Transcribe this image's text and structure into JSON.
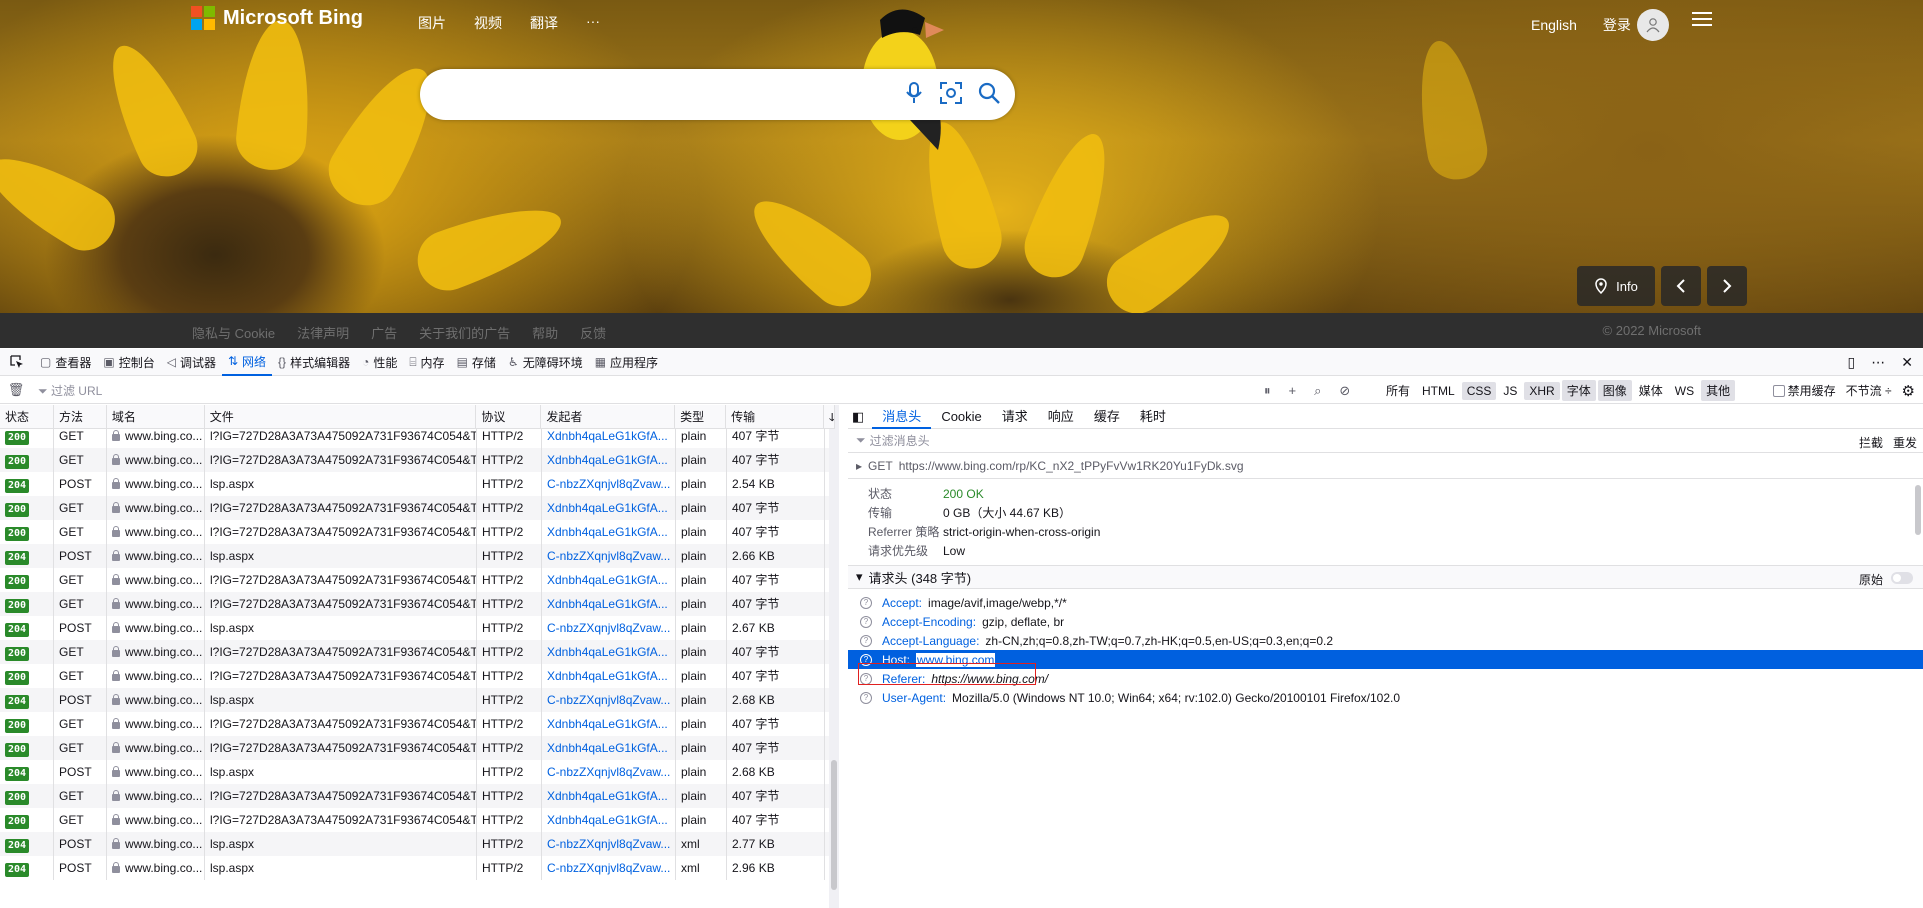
{
  "bing": {
    "logo_text": "Microsoft Bing",
    "nav": [
      "图片",
      "视频",
      "翻译",
      "···"
    ],
    "language": "English",
    "login": "登录",
    "info_label": "Info",
    "footer_links": [
      "隐私与 Cookie",
      "法律声明",
      "广告",
      "关于我们的广告",
      "帮助",
      "反馈"
    ],
    "copyright": "© 2022 Microsoft"
  },
  "devtools": {
    "tabs": [
      "查看器",
      "控制台",
      "调试器",
      "网络",
      "样式编辑器",
      "性能",
      "内存",
      "存储",
      "无障碍环境",
      "应用程序"
    ],
    "active_tab": "网络",
    "filter_placeholder": "过滤 URL",
    "type_filters": [
      "所有",
      "HTML",
      "CSS",
      "JS",
      "XHR",
      "字体",
      "图像",
      "媒体",
      "WS",
      "其他"
    ],
    "disable_cache": "禁用缓存",
    "throttle": "不节流 ÷",
    "columns": [
      "状态",
      "方法",
      "域名",
      "文件",
      "协议",
      "发起者",
      "类型",
      "传输",
      "ↆ"
    ],
    "rows": [
      {
        "status": "200",
        "method": "GET",
        "domain": "www.bing.co...",
        "file": "l?IG=727D28A3A73A475092A731F93674C054&TY",
        "proto": "HTTP/2",
        "initiator": "Xdnbh4qaLeG1kGfA...",
        "type": "plain",
        "size": "407 字节",
        "t": "0"
      },
      {
        "status": "200",
        "method": "GET",
        "domain": "www.bing.co...",
        "file": "l?IG=727D28A3A73A475092A731F93674C054&TY",
        "proto": "HTTP/2",
        "initiator": "Xdnbh4qaLeG1kGfA...",
        "type": "plain",
        "size": "407 字节",
        "t": "0"
      },
      {
        "status": "204",
        "method": "POST",
        "domain": "www.bing.co...",
        "file": "lsp.aspx",
        "proto": "HTTP/2",
        "initiator": "C-nbzZXqnjvl8qZvaw...",
        "type": "plain",
        "size": "2.54 KB",
        "t": "0"
      },
      {
        "status": "200",
        "method": "GET",
        "domain": "www.bing.co...",
        "file": "l?IG=727D28A3A73A475092A731F93674C054&TY",
        "proto": "HTTP/2",
        "initiator": "Xdnbh4qaLeG1kGfA...",
        "type": "plain",
        "size": "407 字节",
        "t": "0"
      },
      {
        "status": "200",
        "method": "GET",
        "domain": "www.bing.co...",
        "file": "l?IG=727D28A3A73A475092A731F93674C054&TY",
        "proto": "HTTP/2",
        "initiator": "Xdnbh4qaLeG1kGfA...",
        "type": "plain",
        "size": "407 字节",
        "t": "0"
      },
      {
        "status": "204",
        "method": "POST",
        "domain": "www.bing.co...",
        "file": "lsp.aspx",
        "proto": "HTTP/2",
        "initiator": "C-nbzZXqnjvl8qZvaw...",
        "type": "plain",
        "size": "2.66 KB",
        "t": "0"
      },
      {
        "status": "200",
        "method": "GET",
        "domain": "www.bing.co...",
        "file": "l?IG=727D28A3A73A475092A731F93674C054&TY",
        "proto": "HTTP/2",
        "initiator": "Xdnbh4qaLeG1kGfA...",
        "type": "plain",
        "size": "407 字节",
        "t": "0"
      },
      {
        "status": "200",
        "method": "GET",
        "domain": "www.bing.co...",
        "file": "l?IG=727D28A3A73A475092A731F93674C054&TY",
        "proto": "HTTP/2",
        "initiator": "Xdnbh4qaLeG1kGfA...",
        "type": "plain",
        "size": "407 字节",
        "t": "0"
      },
      {
        "status": "204",
        "method": "POST",
        "domain": "www.bing.co...",
        "file": "lsp.aspx",
        "proto": "HTTP/2",
        "initiator": "C-nbzZXqnjvl8qZvaw...",
        "type": "plain",
        "size": "2.67 KB",
        "t": "0"
      },
      {
        "status": "200",
        "method": "GET",
        "domain": "www.bing.co...",
        "file": "l?IG=727D28A3A73A475092A731F93674C054&TY",
        "proto": "HTTP/2",
        "initiator": "Xdnbh4qaLeG1kGfA...",
        "type": "plain",
        "size": "407 字节",
        "t": "0"
      },
      {
        "status": "200",
        "method": "GET",
        "domain": "www.bing.co...",
        "file": "l?IG=727D28A3A73A475092A731F93674C054&TY",
        "proto": "HTTP/2",
        "initiator": "Xdnbh4qaLeG1kGfA...",
        "type": "plain",
        "size": "407 字节",
        "t": "0"
      },
      {
        "status": "204",
        "method": "POST",
        "domain": "www.bing.co...",
        "file": "lsp.aspx",
        "proto": "HTTP/2",
        "initiator": "C-nbzZXqnjvl8qZvaw...",
        "type": "plain",
        "size": "2.68 KB",
        "t": "0"
      },
      {
        "status": "200",
        "method": "GET",
        "domain": "www.bing.co...",
        "file": "l?IG=727D28A3A73A475092A731F93674C054&TY",
        "proto": "HTTP/2",
        "initiator": "Xdnbh4qaLeG1kGfA...",
        "type": "plain",
        "size": "407 字节",
        "t": "0"
      },
      {
        "status": "200",
        "method": "GET",
        "domain": "www.bing.co...",
        "file": "l?IG=727D28A3A73A475092A731F93674C054&TY",
        "proto": "HTTP/2",
        "initiator": "Xdnbh4qaLeG1kGfA...",
        "type": "plain",
        "size": "407 字节",
        "t": "0"
      },
      {
        "status": "204",
        "method": "POST",
        "domain": "www.bing.co...",
        "file": "lsp.aspx",
        "proto": "HTTP/2",
        "initiator": "C-nbzZXqnjvl8qZvaw...",
        "type": "plain",
        "size": "2.68 KB",
        "t": "0"
      },
      {
        "status": "200",
        "method": "GET",
        "domain": "www.bing.co...",
        "file": "l?IG=727D28A3A73A475092A731F93674C054&TY",
        "proto": "HTTP/2",
        "initiator": "Xdnbh4qaLeG1kGfA...",
        "type": "plain",
        "size": "407 字节",
        "t": "0"
      },
      {
        "status": "200",
        "method": "GET",
        "domain": "www.bing.co...",
        "file": "l?IG=727D28A3A73A475092A731F93674C054&TY",
        "proto": "HTTP/2",
        "initiator": "Xdnbh4qaLeG1kGfA...",
        "type": "plain",
        "size": "407 字节",
        "t": "0"
      },
      {
        "status": "204",
        "method": "POST",
        "domain": "www.bing.co...",
        "file": "lsp.aspx",
        "proto": "HTTP/2",
        "initiator": "C-nbzZXqnjvl8qZvaw...",
        "type": "xml",
        "size": "2.77 KB",
        "t": "0"
      },
      {
        "status": "204",
        "method": "POST",
        "domain": "www.bing.co...",
        "file": "lsp.aspx",
        "proto": "HTTP/2",
        "initiator": "C-nbzZXqnjvl8qZvaw...",
        "type": "xml",
        "size": "2.96 KB",
        "t": "0"
      }
    ],
    "details": {
      "tabs": [
        "消息头",
        "Cookie",
        "请求",
        "响应",
        "缓存",
        "耗时"
      ],
      "filter_placeholder": "过滤消息头",
      "block": "拦截",
      "resend": "重发",
      "request_method": "GET",
      "request_url": "https://www.bing.com/rp/KC_nX2_tPPyFvVw1RK20Yu1FyDk.svg",
      "summary": [
        {
          "k": "状态",
          "v": "200 OK"
        },
        {
          "k": "传输",
          "v": "0 GB（大小 44.67 KB）"
        },
        {
          "k": "Referrer 策略",
          "v": "strict-origin-when-cross-origin"
        },
        {
          "k": "请求优先级",
          "v": "Low"
        }
      ],
      "section_title": "请求头 (348 字节)",
      "raw_label": "原始",
      "headers": [
        {
          "k": "Accept:",
          "v": "image/avif,image/webp,*/*"
        },
        {
          "k": "Accept-Encoding:",
          "v": "gzip, deflate, br"
        },
        {
          "k": "Accept-Language:",
          "v": "zh-CN,zh;q=0.8,zh-TW;q=0.7,zh-HK;q=0.5,en-US;q=0.3,en;q=0.2"
        },
        {
          "k": "Host:",
          "v": "www.bing.com"
        },
        {
          "k": "Referer:",
          "v": "https://www.bing.com/"
        },
        {
          "k": "User-Agent:",
          "v": "Mozilla/5.0 (Windows NT 10.0; Win64; x64; rv:102.0) Gecko/20100101 Firefox/102.0"
        }
      ]
    }
  }
}
